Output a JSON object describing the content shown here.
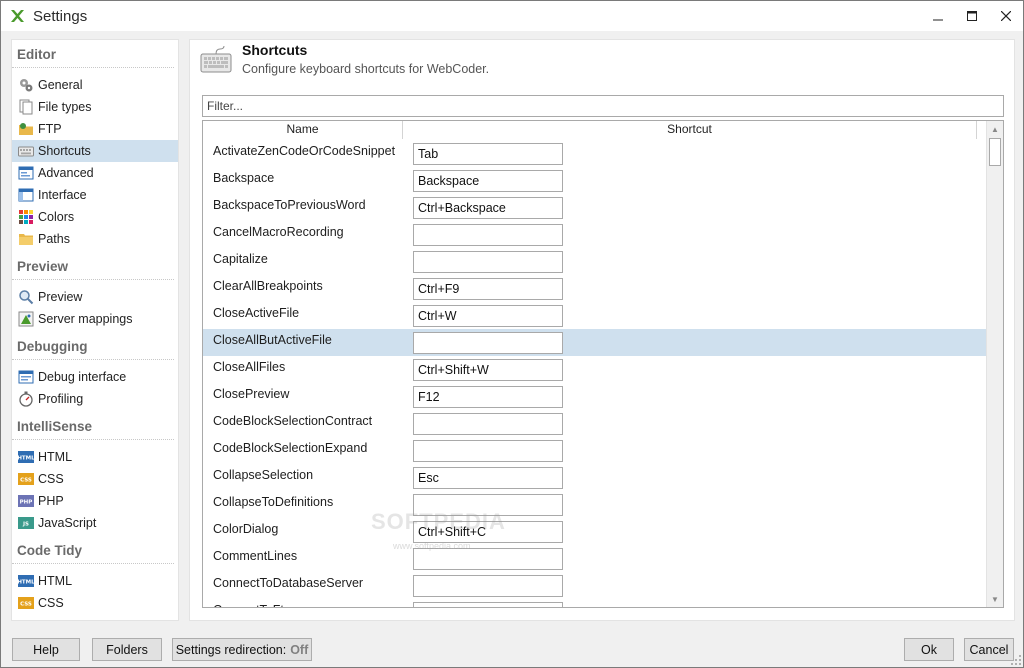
{
  "window": {
    "title": "Settings",
    "app_icon": "webcoder-logo"
  },
  "window_controls": {
    "minimize": "–",
    "maximize": "☐",
    "close": "✕"
  },
  "sidebar": {
    "groups": [
      {
        "heading": "Editor",
        "items": [
          {
            "label": "General",
            "icon": "gears-icon"
          },
          {
            "label": "File types",
            "icon": "files-icon"
          },
          {
            "label": "FTP",
            "icon": "ftp-folder-icon"
          },
          {
            "label": "Shortcuts",
            "icon": "keyboard-icon",
            "selected": true
          },
          {
            "label": "Advanced",
            "icon": "advanced-icon"
          },
          {
            "label": "Interface",
            "icon": "interface-icon"
          },
          {
            "label": "Colors",
            "icon": "colors-icon"
          },
          {
            "label": "Paths",
            "icon": "folder-icon"
          }
        ]
      },
      {
        "heading": "Preview",
        "items": [
          {
            "label": "Preview",
            "icon": "magnifier-icon"
          },
          {
            "label": "Server mappings",
            "icon": "server-map-icon"
          }
        ]
      },
      {
        "heading": "Debugging",
        "items": [
          {
            "label": "Debug interface",
            "icon": "debug-window-icon"
          },
          {
            "label": "Profiling",
            "icon": "stopwatch-icon"
          }
        ]
      },
      {
        "heading": "IntelliSense",
        "items": [
          {
            "label": "HTML",
            "icon": "html-icon",
            "badge": "HTML"
          },
          {
            "label": "CSS",
            "icon": "css-icon",
            "badge": "CSS"
          },
          {
            "label": "PHP",
            "icon": "php-icon",
            "badge": "PHP"
          },
          {
            "label": "JavaScript",
            "icon": "javascript-icon",
            "badge": "JS"
          }
        ]
      },
      {
        "heading": "Code Tidy",
        "items": [
          {
            "label": "HTML",
            "icon": "html-icon",
            "badge": "HTML"
          },
          {
            "label": "CSS",
            "icon": "css-icon",
            "badge": "CSS"
          }
        ]
      }
    ]
  },
  "page": {
    "title": "Shortcuts",
    "subtitle": "Configure keyboard shortcuts for WebCoder.",
    "icon": "keyboard-icon"
  },
  "filter": {
    "placeholder": "Filter...",
    "value": ""
  },
  "grid": {
    "columns": {
      "name": "Name",
      "shortcut": "Shortcut"
    },
    "rows": [
      {
        "name": "ActivateZenCodeOrCodeSnippet",
        "shortcut": "Tab"
      },
      {
        "name": "Backspace",
        "shortcut": "Backspace"
      },
      {
        "name": "BackspaceToPreviousWord",
        "shortcut": "Ctrl+Backspace"
      },
      {
        "name": "CancelMacroRecording",
        "shortcut": ""
      },
      {
        "name": "Capitalize",
        "shortcut": ""
      },
      {
        "name": "ClearAllBreakpoints",
        "shortcut": "Ctrl+F9"
      },
      {
        "name": "CloseActiveFile",
        "shortcut": "Ctrl+W"
      },
      {
        "name": "CloseAllButActiveFile",
        "shortcut": "",
        "selected": true
      },
      {
        "name": "CloseAllFiles",
        "shortcut": "Ctrl+Shift+W"
      },
      {
        "name": "ClosePreview",
        "shortcut": "F12"
      },
      {
        "name": "CodeBlockSelectionContract",
        "shortcut": ""
      },
      {
        "name": "CodeBlockSelectionExpand",
        "shortcut": ""
      },
      {
        "name": "CollapseSelection",
        "shortcut": "Esc"
      },
      {
        "name": "CollapseToDefinitions",
        "shortcut": ""
      },
      {
        "name": "ColorDialog",
        "shortcut": "Ctrl+Shift+C"
      },
      {
        "name": "CommentLines",
        "shortcut": ""
      },
      {
        "name": "ConnectToDatabaseServer",
        "shortcut": ""
      },
      {
        "name": "ConnectToFtp",
        "shortcut": ""
      }
    ]
  },
  "watermark": {
    "text": "SOFTPEDIA",
    "sub": "www.softpedia.com"
  },
  "footer": {
    "help": "Help",
    "folders": "Folders",
    "redirection_label": "Settings redirection:",
    "redirection_value": "Off",
    "ok": "Ok",
    "cancel": "Cancel"
  },
  "colors": {
    "selection": "#cfe0ee",
    "html_badge": "#2f6db3",
    "css_badge": "#e4a11b",
    "php_badge": "#6c73b5",
    "js_badge": "#3a9a8b"
  }
}
